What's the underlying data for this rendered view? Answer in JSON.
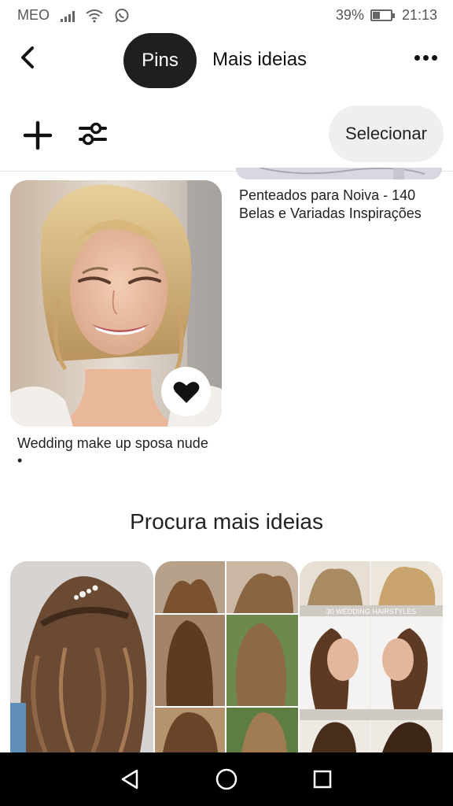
{
  "status_bar": {
    "carrier": "MEO",
    "battery_percent": "39%",
    "time": "21:13",
    "battery_level": 0.39
  },
  "nav": {
    "back_icon": "chevron-left-icon",
    "active_tab": "Pins",
    "other_tab": "Mais ideias",
    "more_icon": "more-horizontal-icon"
  },
  "toolbar": {
    "add_icon": "plus-icon",
    "filter_icon": "sliders-icon",
    "select_label": "Selecionar"
  },
  "pins": [
    {
      "title": "Wedding make up sposa nude •",
      "saved": true
    },
    {
      "title": "Penteados para Noiva - 140 Belas e Variadas Inspirações"
    }
  ],
  "more_ideas": {
    "title": "Procura mais ideias",
    "board3_banner": "30 WEDDING HAIRSTYLES"
  },
  "colors": {
    "active_tab_bg": "#1f1f1f",
    "select_bg": "#efefef",
    "nav_bar_bg": "#000000"
  }
}
